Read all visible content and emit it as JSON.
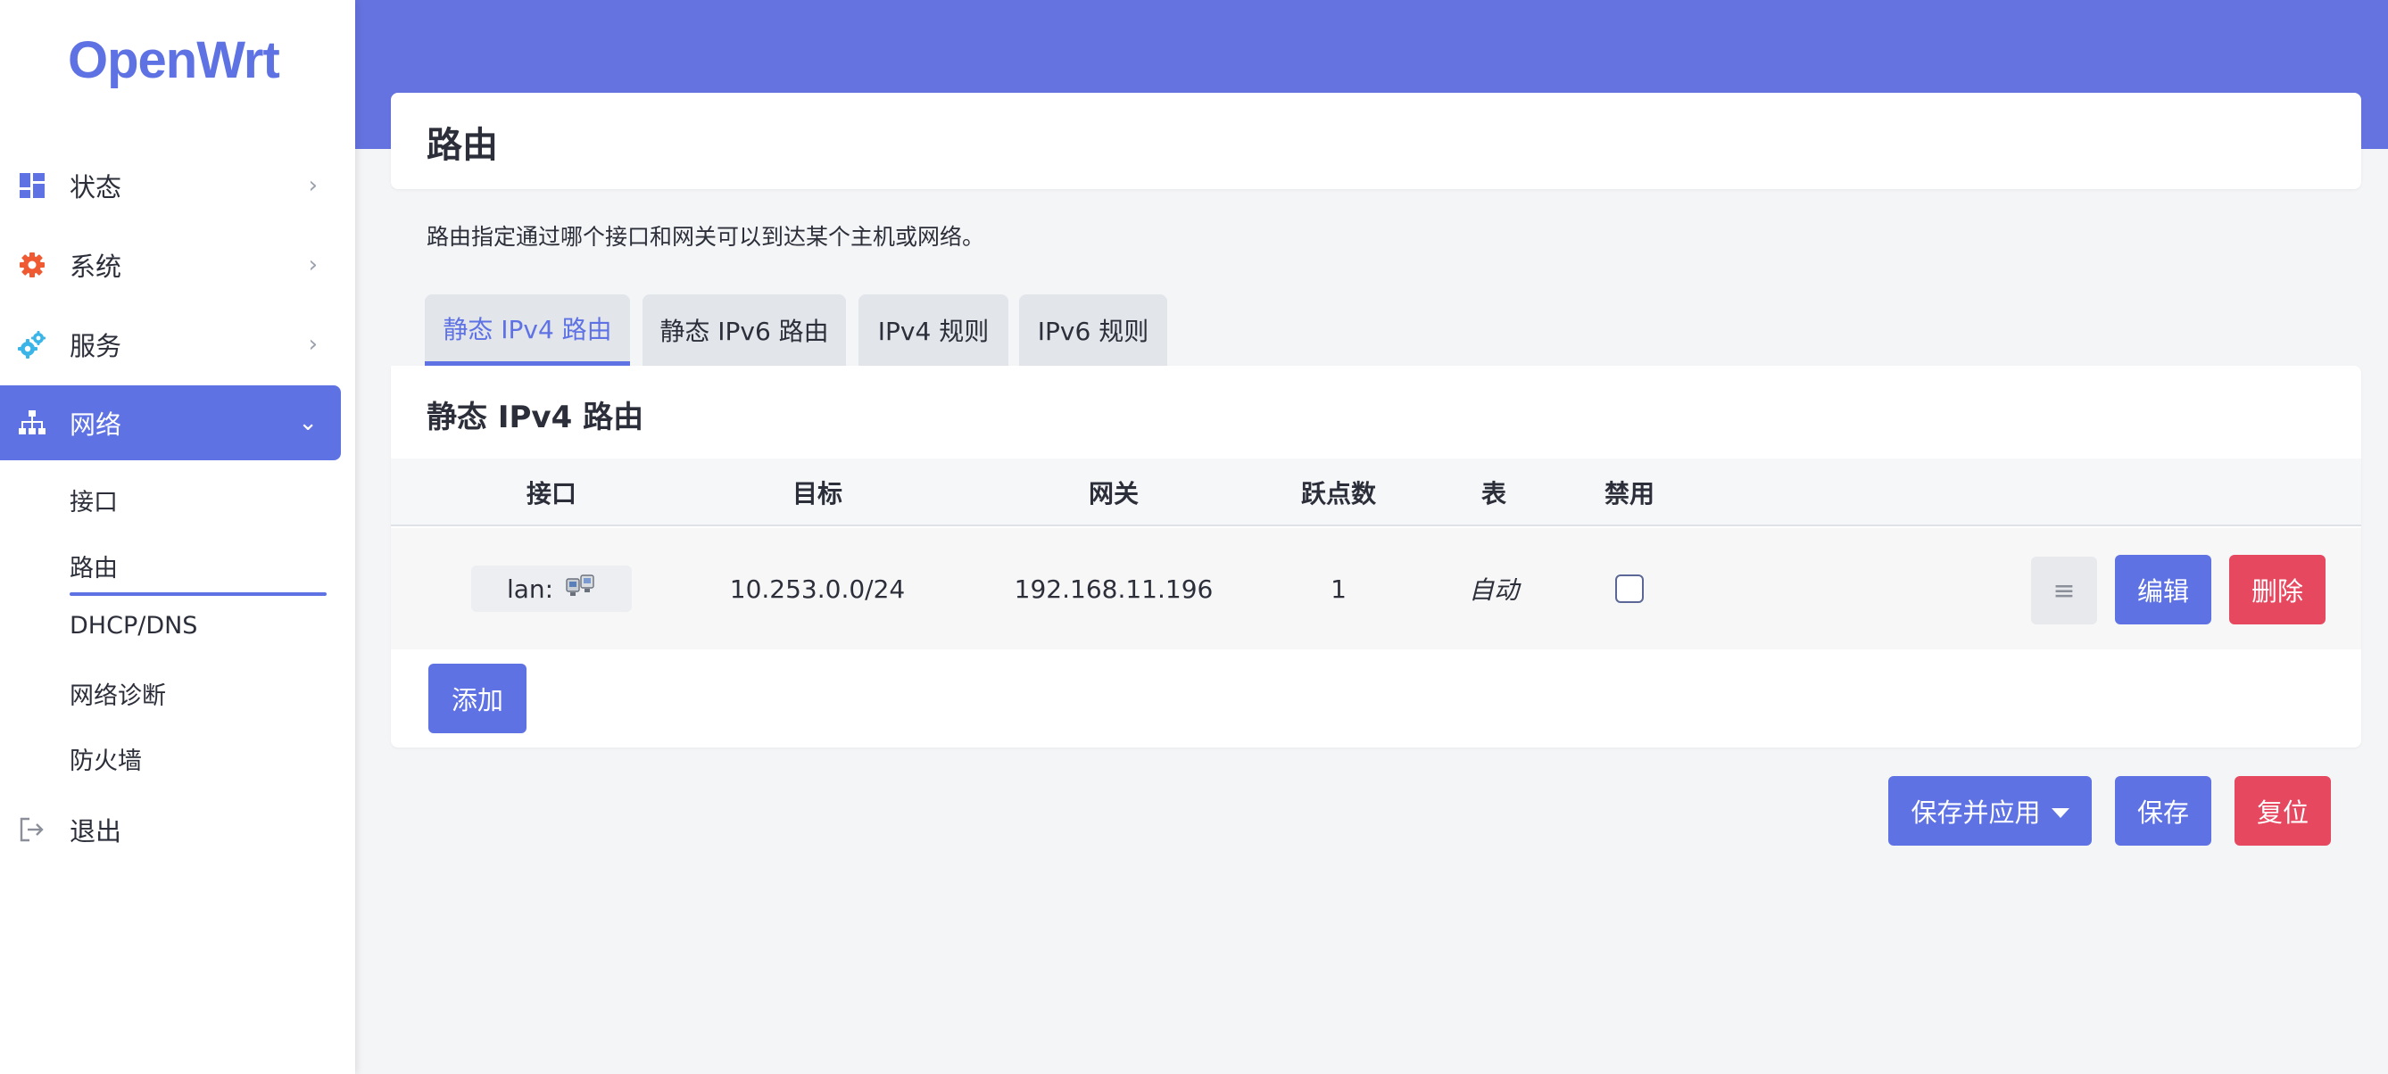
{
  "brand": "OpenWrt",
  "sidebar": {
    "items": [
      {
        "label": "状态",
        "icon": "dashboard-icon",
        "icon_color": "#5e72e4"
      },
      {
        "label": "系统",
        "icon": "gear-icon",
        "icon_color": "#f05a32"
      },
      {
        "label": "服务",
        "icon": "services-gear-icon",
        "icon_color": "#3bb5e8"
      },
      {
        "label": "网络",
        "icon": "network-icon",
        "icon_color": "#ffffff"
      },
      {
        "label": "退出",
        "icon": "logout-icon",
        "icon_color": "#8a8f99"
      }
    ],
    "network_sub": [
      "接口",
      "路由",
      "DHCP/DNS",
      "网络诊断",
      "防火墙"
    ],
    "active_item": "网络",
    "active_sub": "路由"
  },
  "page": {
    "title": "路由",
    "description": "路由指定通过哪个接口和网关可以到达某个主机或网络。"
  },
  "tabs": [
    {
      "label": "静态 IPv4 路由",
      "active": true
    },
    {
      "label": "静态 IPv6 路由",
      "active": false
    },
    {
      "label": "IPv4 规则",
      "active": false
    },
    {
      "label": "IPv6 规则",
      "active": false
    }
  ],
  "section": {
    "title": "静态 IPv4 路由",
    "columns": [
      "接口",
      "目标",
      "网关",
      "跃点数",
      "表",
      "禁用"
    ],
    "rows": [
      {
        "interface": "lan:",
        "target": "10.253.0.0/24",
        "gateway": "192.168.11.196",
        "metric": "1",
        "table": "自动",
        "disabled": false
      }
    ],
    "row_actions": {
      "sort": "≡",
      "edit": "编辑",
      "delete": "删除"
    },
    "add_label": "添加"
  },
  "footer": {
    "save_apply": "保存并应用",
    "save": "保存",
    "reset": "复位"
  },
  "colors": {
    "accent": "#5e72e4",
    "header": "#6573e0",
    "danger": "#e5485f"
  }
}
